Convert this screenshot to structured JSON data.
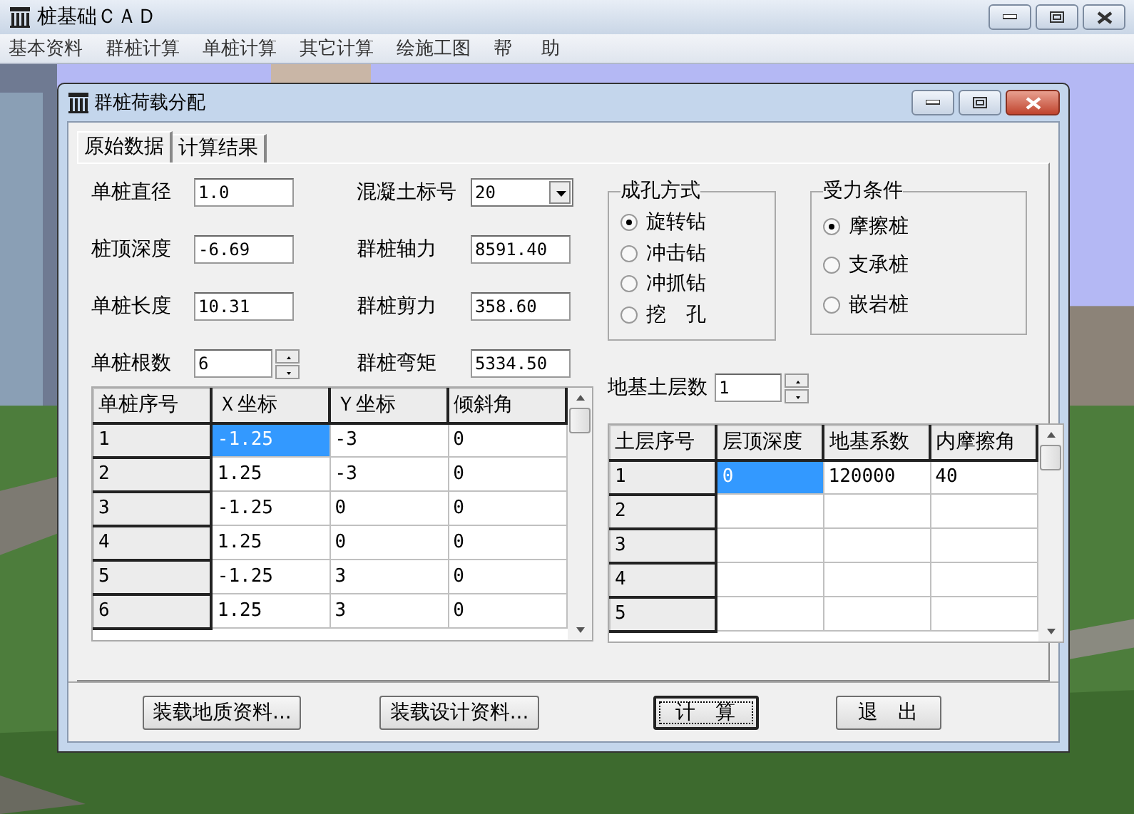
{
  "app": {
    "title": "桩基础ＣＡＤ",
    "menu": [
      "基本资料",
      "群桩计算",
      "单桩计算",
      "其它计算",
      "绘施工图",
      "帮     助"
    ]
  },
  "dialog": {
    "title": "群桩荷载分配",
    "tabs": [
      {
        "label": "原始数据",
        "selected": true
      },
      {
        "label": "计算结果",
        "selected": false
      }
    ],
    "left_fields": [
      {
        "label": "单桩直径",
        "value": "1.0",
        "kind": "text"
      },
      {
        "label": "桩顶深度",
        "value": "-6.69",
        "kind": "text"
      },
      {
        "label": "单桩长度",
        "value": "10.31",
        "kind": "text"
      },
      {
        "label": "单桩根数",
        "value": "6",
        "kind": "spin"
      }
    ],
    "right_fields": [
      {
        "label": "混凝土标号",
        "value": "20",
        "kind": "combo"
      },
      {
        "label": "群桩轴力",
        "value": "8591.40",
        "kind": "text"
      },
      {
        "label": "群桩剪力",
        "value": "358.60",
        "kind": "text"
      },
      {
        "label": "群桩弯矩",
        "value": "5334.50",
        "kind": "text"
      }
    ],
    "groups": [
      {
        "title": "成孔方式",
        "options": [
          {
            "label": "旋转钻",
            "selected": true
          },
          {
            "label": "冲击钻",
            "selected": false
          },
          {
            "label": "冲抓钻",
            "selected": false
          },
          {
            "label": "挖　孔",
            "selected": false
          }
        ]
      },
      {
        "title": "受力条件",
        "options": [
          {
            "label": "摩擦桩",
            "selected": true
          },
          {
            "label": "支承桩",
            "selected": false
          },
          {
            "label": "嵌岩桩",
            "selected": false
          }
        ]
      }
    ],
    "soil_layers": {
      "label": "地基土层数",
      "value": "1"
    },
    "pile_table": {
      "columns": [
        "单桩序号",
        "Ｘ坐标",
        "Ｙ坐标",
        "倾斜角"
      ],
      "rows": [
        {
          "cells": [
            {
              "kind": "header",
              "text": "1",
              "selected": false
            },
            {
              "kind": "data",
              "text": "-1.25",
              "selected": true
            },
            {
              "kind": "data",
              "text": "-3",
              "selected": false
            },
            {
              "kind": "data",
              "text": "0",
              "selected": false
            }
          ]
        },
        {
          "cells": [
            {
              "kind": "header",
              "text": "2",
              "selected": false
            },
            {
              "kind": "data",
              "text": "1.25",
              "selected": false
            },
            {
              "kind": "data",
              "text": "-3",
              "selected": false
            },
            {
              "kind": "data",
              "text": "0",
              "selected": false
            }
          ]
        },
        {
          "cells": [
            {
              "kind": "header",
              "text": "3",
              "selected": false
            },
            {
              "kind": "data",
              "text": "-1.25",
              "selected": false
            },
            {
              "kind": "data",
              "text": "0",
              "selected": false
            },
            {
              "kind": "data",
              "text": "0",
              "selected": false
            }
          ]
        },
        {
          "cells": [
            {
              "kind": "header",
              "text": "4",
              "selected": false
            },
            {
              "kind": "data",
              "text": "1.25",
              "selected": false
            },
            {
              "kind": "data",
              "text": "0",
              "selected": false
            },
            {
              "kind": "data",
              "text": "0",
              "selected": false
            }
          ]
        },
        {
          "cells": [
            {
              "kind": "header",
              "text": "5",
              "selected": false
            },
            {
              "kind": "data",
              "text": "-1.25",
              "selected": false
            },
            {
              "kind": "data",
              "text": "3",
              "selected": false
            },
            {
              "kind": "data",
              "text": "0",
              "selected": false
            }
          ]
        },
        {
          "cells": [
            {
              "kind": "header",
              "text": "6",
              "selected": false
            },
            {
              "kind": "data",
              "text": "1.25",
              "selected": false
            },
            {
              "kind": "data",
              "text": "3",
              "selected": false
            },
            {
              "kind": "data",
              "text": "0",
              "selected": false
            }
          ]
        }
      ]
    },
    "soil_table": {
      "columns": [
        "土层序号",
        "层顶深度",
        "地基系数",
        "内摩擦角"
      ],
      "rows": [
        {
          "cells": [
            {
              "kind": "header",
              "text": "1",
              "selected": false
            },
            {
              "kind": "data",
              "text": "0",
              "selected": true
            },
            {
              "kind": "data",
              "text": "120000",
              "selected": false
            },
            {
              "kind": "data",
              "text": "40",
              "selected": false
            }
          ]
        },
        {
          "cells": [
            {
              "kind": "header",
              "text": "2",
              "selected": false
            },
            {
              "kind": "data",
              "selected": false
            },
            {
              "kind": "data",
              "selected": false
            },
            {
              "kind": "data",
              "selected": false
            }
          ]
        },
        {
          "cells": [
            {
              "kind": "header",
              "text": "3",
              "selected": false
            },
            {
              "kind": "data",
              "selected": false
            },
            {
              "kind": "data",
              "selected": false
            },
            {
              "kind": "data",
              "selected": false
            }
          ]
        },
        {
          "cells": [
            {
              "kind": "header",
              "text": "4",
              "selected": false
            },
            {
              "kind": "data",
              "selected": false
            },
            {
              "kind": "data",
              "selected": false
            },
            {
              "kind": "data",
              "selected": false
            }
          ]
        },
        {
          "cells": [
            {
              "kind": "header",
              "text": "5",
              "selected": false
            },
            {
              "kind": "data",
              "selected": false
            },
            {
              "kind": "data",
              "selected": false
            },
            {
              "kind": "data",
              "selected": false
            }
          ]
        }
      ]
    },
    "buttons": [
      {
        "label": "装载地质资料...",
        "default": false
      },
      {
        "label": "装载设计资料...",
        "default": false
      },
      {
        "label": "计　算",
        "default": true
      },
      {
        "label": "退　出",
        "default": false
      }
    ]
  }
}
